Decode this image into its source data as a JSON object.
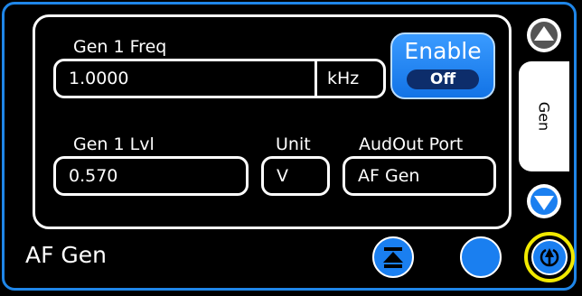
{
  "freq": {
    "label": "Gen 1 Freq",
    "value": "1.0000",
    "unit": "kHz"
  },
  "enable": {
    "label": "Enable",
    "state": "Off"
  },
  "level": {
    "label": "Gen 1 Lvl",
    "value": "0.570"
  },
  "unit": {
    "label": "Unit",
    "value": "V"
  },
  "port": {
    "label": "AudOut Port",
    "value": "AF Gen"
  },
  "side_tab": {
    "label": "Gen"
  },
  "screen": {
    "title": "AF Gen"
  },
  "colors": {
    "accent": "#1f86e8",
    "button": "#1a7ff0",
    "highlight": "#f2ea00"
  },
  "icons": [
    "chevron-up-icon",
    "chevron-down-icon",
    "expand-panel-icon",
    "blank-circle-icon",
    "return-icon"
  ]
}
